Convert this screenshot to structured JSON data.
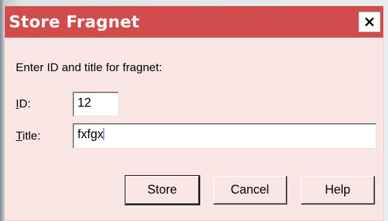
{
  "dialog": {
    "title": "Store Fragnet",
    "close_label": "×",
    "prompt": "Enter ID and title for fragnet:",
    "id_label_underlined": "I",
    "id_label_rest": "D:",
    "id_value": "12",
    "title_label_underlined": "T",
    "title_label_rest": "itle:",
    "title_value": "fxfgx",
    "buttons": {
      "store": "Store",
      "cancel": "Cancel",
      "help": "Help"
    }
  }
}
